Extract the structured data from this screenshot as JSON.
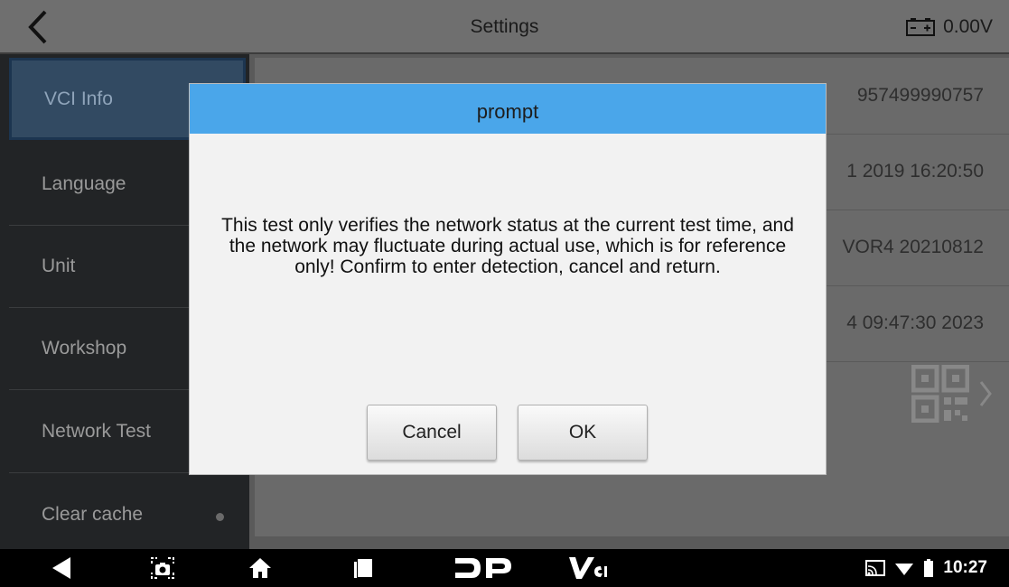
{
  "header": {
    "title": "Settings",
    "battery_voltage": "0.00V",
    "back_icon": "back-chevron-icon",
    "battery_icon": "car-battery-icon"
  },
  "sidebar": {
    "items": [
      {
        "label": "VCI Info",
        "active": true
      },
      {
        "label": "Language",
        "active": false
      },
      {
        "label": "Unit",
        "active": false
      },
      {
        "label": "Workshop",
        "active": false
      },
      {
        "label": "Network Test",
        "active": false
      },
      {
        "label": "Clear cache",
        "active": false
      }
    ]
  },
  "content": {
    "rows": [
      {
        "value": "957499990757"
      },
      {
        "value": "1 2019 16:20:50"
      },
      {
        "value": "VOR4 20210812"
      },
      {
        "value": "4 09:47:30 2023"
      }
    ],
    "qr_icon": "qr-code-icon"
  },
  "dialog": {
    "title": "prompt",
    "message": "This test only verifies the network status at the current test time, and the network may fluctuate during actual use, which is for reference only! Confirm to enter detection, cancel and return.",
    "cancel_label": "Cancel",
    "ok_label": "OK"
  },
  "navbar": {
    "time": "10:27",
    "icons": [
      "nav-back-icon",
      "screenshot-icon",
      "home-icon",
      "recents-icon",
      "dp-logo-icon",
      "vci-logo-icon",
      "cast-icon",
      "wifi-icon",
      "battery-icon"
    ]
  },
  "colors": {
    "dialog_header": "#4aa6ea",
    "sidebar_active": "#324a62",
    "sidebar_bg": "#222426",
    "topbar_bg": "#6f6f6f"
  }
}
